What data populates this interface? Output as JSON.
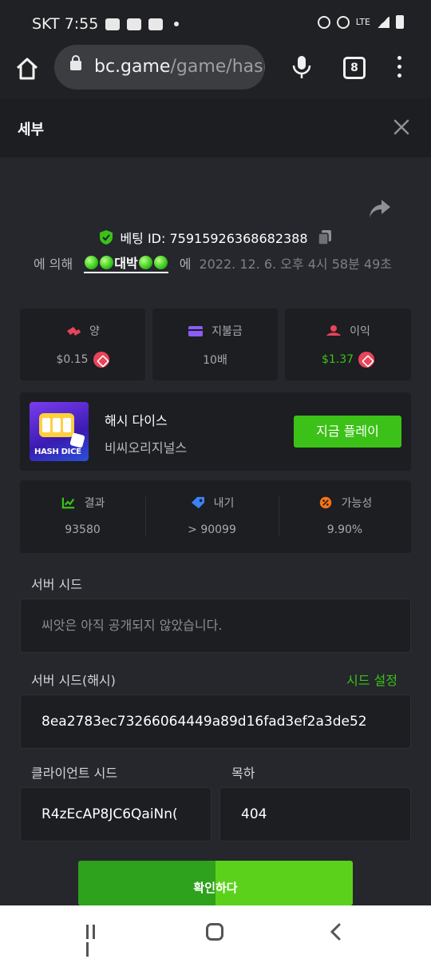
{
  "status_bar": {
    "carrier_time": "SKT 7:55",
    "network": "LTE"
  },
  "browser": {
    "url_domain": "bc.game",
    "url_path": "/game/hasl",
    "tab_count": "8"
  },
  "modal": {
    "title": "세부"
  },
  "bet": {
    "id_label": "베팅 ID: 75915926368682388",
    "by": "에 의해",
    "user": "대박",
    "at": "에",
    "date": "2022. 12. 6. 오후 4시 58분 49초"
  },
  "stats": [
    {
      "label": "양",
      "value": "$0.15",
      "icon": "coins-icon",
      "color": "#e8445a"
    },
    {
      "label": "지불금",
      "value": "10배",
      "icon": "wallet-icon",
      "color": "#8b5cf6"
    },
    {
      "label": "이익",
      "value": "$1.37",
      "icon": "profit-icon",
      "color": "#e8445a"
    }
  ],
  "game": {
    "thumb_text": "HASH DICE",
    "name": "해시 다이스",
    "provider": "비씨오리지널스",
    "play_label": "지금 플레이"
  },
  "result": [
    {
      "label": "결과",
      "value": "93580",
      "icon": "chart-icon",
      "color": "#3bc117"
    },
    {
      "label": "내기",
      "value": "> 90099",
      "icon": "ticket-icon",
      "color": "#3b82f6"
    },
    {
      "label": "가능성",
      "value": "9.90%",
      "icon": "percent-icon",
      "color": "#f97316"
    }
  ],
  "form": {
    "server_seed_label": "서버 시드",
    "server_seed_value": "씨앗은 아직 공개되지 않았습니다.",
    "server_seed_hash_label": "서버 시드(해시)",
    "seed_settings": "시드 설정",
    "server_seed_hash_value": "8ea2783ec73266064449a89d16fad3ef2a3de52",
    "client_seed_label": "클라이언트 시드",
    "client_seed_value": "R4zEcAP8JC6QaiNn(",
    "nonce_label": "목하",
    "nonce_value": "404",
    "confirm_label": "확인하다"
  }
}
